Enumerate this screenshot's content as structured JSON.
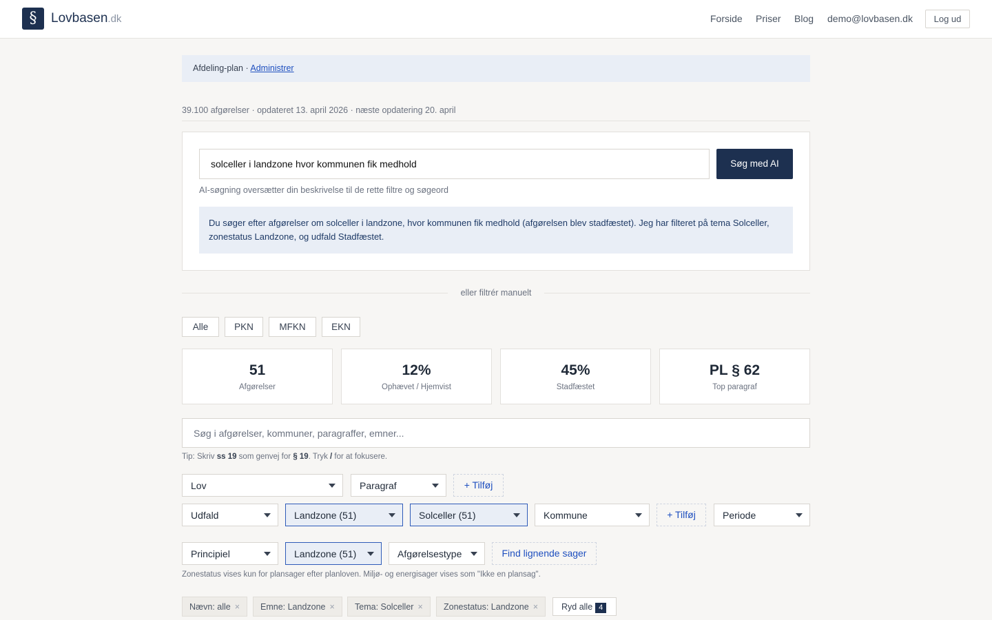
{
  "header": {
    "logo_glyph": "§",
    "brand": "Lovbasen",
    "brand_tld": ".dk",
    "nav": [
      "Forside",
      "Priser",
      "Blog",
      "demo@lovbasen.dk"
    ],
    "logout_label": "Log ud"
  },
  "planbar": {
    "text": "Afdeling-plan · ",
    "link": "Administrer"
  },
  "meta": "39.100 afgørelser · opdateret 13. april 2026 · næste opdatering 20. april",
  "ai": {
    "query": "solceller i landzone hvor kommunen fik medhold",
    "button": "Søg med AI",
    "hint": "AI-søgning oversætter din beskrivelse til de rette filtre og søgeord",
    "response": "Du søger efter afgørelser om solceller i landzone, hvor kommunen fik medhold (afgørelsen blev stadfæstet). Jeg har filteret på tema Solceller, zonestatus Landzone, og udfald Stadfæstet."
  },
  "divider_text": "eller filtrér manuelt",
  "tabs": [
    "Alle",
    "PKN",
    "MFKN",
    "EKN"
  ],
  "stats": [
    {
      "value": "51",
      "label": "Afgørelser"
    },
    {
      "value": "12%",
      "label": "Ophævet / Hjemvist"
    },
    {
      "value": "45%",
      "label": "Stadfæstet"
    },
    {
      "value": "PL § 62",
      "label": "Top paragraf"
    }
  ],
  "search": {
    "placeholder": "Søg i afgørelser, kommuner, paragraffer, emner..."
  },
  "tip": {
    "t1": "Tip: Skriv ",
    "k1": "ss 19",
    "t2": " som genvej for ",
    "k2": "§ 19",
    "t3": ". Tryk ",
    "k3": "/",
    "t4": " for at fokusere."
  },
  "filters": {
    "row1": {
      "lov": "Lov",
      "paragraf": "Paragraf",
      "add": "+ Tilføj"
    },
    "row2": {
      "udfald": "Udfald",
      "landzone": "Landzone (51)",
      "solceller": "Solceller (51)",
      "kommune": "Kommune",
      "add": "+ Tilføj",
      "periode": "Periode"
    },
    "row3": {
      "principiel": "Principiel",
      "landzone": "Landzone (51)",
      "type": "Afgørelsestype",
      "similar": "Find lignende sager"
    }
  },
  "note": "Zonestatus vises kun for plansager efter planloven. Miljø- og energisager vises som \"Ikke en plansag\".",
  "chips": [
    "Nævn: alle",
    "Emne: Landzone",
    "Tema: Solceller",
    "Zonestatus: Landzone"
  ],
  "chip_remove": "×",
  "clear": {
    "label": "Ryd alle",
    "count": "4"
  },
  "colors": {
    "primary": "#1d3050",
    "accent": "#1e4fbf",
    "active_bg": "#e9eef6"
  }
}
